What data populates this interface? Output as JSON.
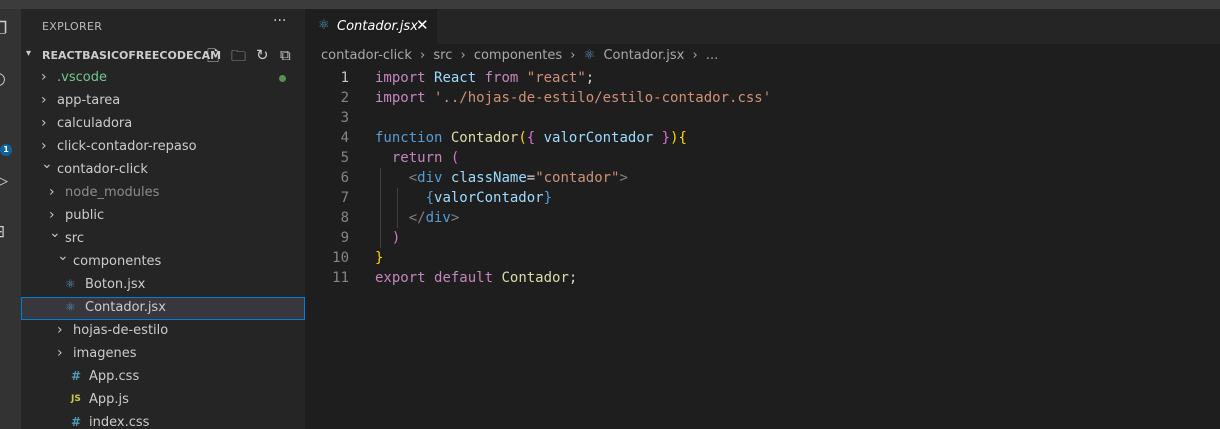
{
  "sidebar": {
    "title": "EXPLORER",
    "more": "···",
    "section_title": "REACTBASICOFREECODECAM",
    "tree": [
      {
        "label": ".vscode",
        "type": "folder",
        "expanded": false,
        "depth": 0,
        "color": "#73c991",
        "status_dot": true
      },
      {
        "label": "app-tarea",
        "type": "folder",
        "expanded": false,
        "depth": 0
      },
      {
        "label": "calculadora",
        "type": "folder",
        "expanded": false,
        "depth": 0
      },
      {
        "label": "click-contador-repaso",
        "type": "folder",
        "expanded": false,
        "depth": 0
      },
      {
        "label": "contador-click",
        "type": "folder",
        "expanded": true,
        "depth": 0
      },
      {
        "label": "node_modules",
        "type": "folder",
        "expanded": false,
        "depth": 1,
        "color": "#8c8c8c"
      },
      {
        "label": "public",
        "type": "folder",
        "expanded": false,
        "depth": 1
      },
      {
        "label": "src",
        "type": "folder",
        "expanded": true,
        "depth": 1
      },
      {
        "label": "componentes",
        "type": "folder",
        "expanded": true,
        "depth": 2
      },
      {
        "label": "Boton.jsx",
        "type": "file",
        "icon": "react",
        "depth": 3
      },
      {
        "label": "Contador.jsx",
        "type": "file",
        "icon": "react",
        "depth": 3,
        "selected": true
      },
      {
        "label": "hojas-de-estilo",
        "type": "folder",
        "expanded": false,
        "depth": 2
      },
      {
        "label": "imagenes",
        "type": "folder",
        "expanded": false,
        "depth": 2
      },
      {
        "label": "App.css",
        "type": "file",
        "icon": "css",
        "depth": 2
      },
      {
        "label": "App.js",
        "type": "file",
        "icon": "js",
        "depth": 2
      },
      {
        "label": "index.css",
        "type": "file",
        "icon": "css",
        "depth": 2
      }
    ]
  },
  "icons": {
    "react": "⚛",
    "css": "#",
    "js": "JS",
    "chevron_right": "›",
    "chevron_down": "⌄"
  },
  "icon_colors": {
    "react": "#519aba",
    "css": "#519aba",
    "js": "#cbcb41"
  },
  "tab": {
    "label": "Contador.jsx",
    "close": "✕"
  },
  "breadcrumb": {
    "items": [
      "contador-click",
      "src",
      "componentes",
      "Contador.jsx",
      "..."
    ],
    "separator": "›"
  },
  "editor": {
    "current_line": 1,
    "lines": [
      [
        [
          "kwc",
          "import"
        ],
        [
          "txt",
          " "
        ],
        [
          "var",
          "React"
        ],
        [
          "txt",
          " "
        ],
        [
          "kwc",
          "from"
        ],
        [
          "txt",
          " "
        ],
        [
          "str",
          "\"react\""
        ],
        [
          "txt",
          ";"
        ]
      ],
      [
        [
          "kwc",
          "import"
        ],
        [
          "txt",
          " "
        ],
        [
          "str",
          "'../hojas-de-estilo/estilo-contador.css'"
        ]
      ],
      [],
      [
        [
          "kw",
          "function"
        ],
        [
          "txt",
          " "
        ],
        [
          "fn",
          "Contador"
        ],
        [
          "br1",
          "("
        ],
        [
          "br2",
          "{"
        ],
        [
          "txt",
          " "
        ],
        [
          "var",
          "valorContador"
        ],
        [
          "txt",
          " "
        ],
        [
          "br2",
          "}"
        ],
        [
          "br1",
          ")"
        ],
        [
          "br1",
          "{"
        ]
      ],
      [
        [
          "txt",
          "  "
        ],
        [
          "kwc",
          "return"
        ],
        [
          "txt",
          " "
        ],
        [
          "br2",
          "("
        ]
      ],
      [
        [
          "txt",
          "    "
        ],
        [
          "punc",
          "<"
        ],
        [
          "tag",
          "div"
        ],
        [
          "txt",
          " "
        ],
        [
          "var",
          "className"
        ],
        [
          "txt",
          "="
        ],
        [
          "str",
          "\"contador\""
        ],
        [
          "punc",
          ">"
        ]
      ],
      [
        [
          "txt",
          "      "
        ],
        [
          "kw",
          "{"
        ],
        [
          "var",
          "valorContador"
        ],
        [
          "kw",
          "}"
        ]
      ],
      [
        [
          "txt",
          "    "
        ],
        [
          "punc",
          "</"
        ],
        [
          "tag",
          "div"
        ],
        [
          "punc",
          ">"
        ]
      ],
      [
        [
          "txt",
          "  "
        ],
        [
          "br2",
          ")"
        ]
      ],
      [
        [
          "br1",
          "}"
        ]
      ],
      [
        [
          "kwc",
          "export"
        ],
        [
          "txt",
          " "
        ],
        [
          "kwc",
          "default"
        ],
        [
          "txt",
          " "
        ],
        [
          "fn",
          "Contador"
        ],
        [
          "txt",
          ";"
        ]
      ]
    ]
  }
}
